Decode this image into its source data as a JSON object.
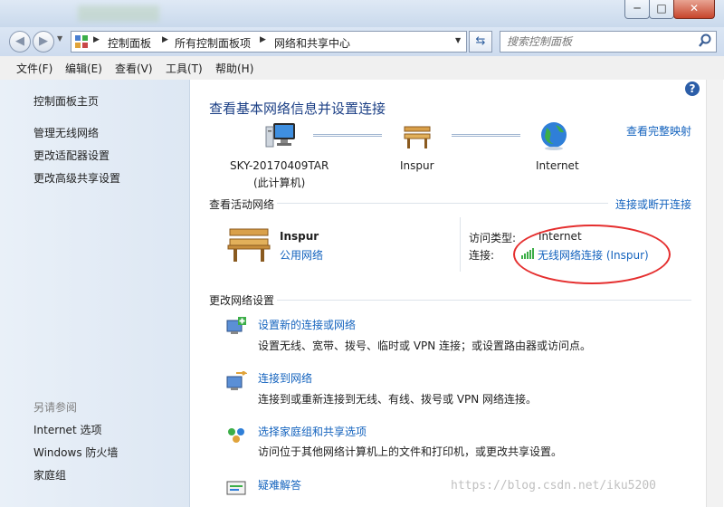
{
  "window": {
    "minimize": "─",
    "maximize": "□",
    "close": "✕"
  },
  "address": {
    "crumbs": [
      "控制面板",
      "所有控制面板项",
      "网络和共享中心"
    ],
    "search_placeholder": "搜索控制面板"
  },
  "menu": [
    "文件(F)",
    "编辑(E)",
    "查看(V)",
    "工具(T)",
    "帮助(H)"
  ],
  "sidebar": {
    "home": "控制面板主页",
    "links": [
      "管理无线网络",
      "更改适配器设置",
      "更改高级共享设置"
    ],
    "see_also_title": "另请参阅",
    "see_also": [
      "Internet 选项",
      "Windows 防火墙",
      "家庭组"
    ]
  },
  "main": {
    "title": "查看基本网络信息并设置连接",
    "full_map": "查看完整映射",
    "map": {
      "computer_name": "SKY-20170409TAR",
      "computer_sub": "(此计算机)",
      "network": "Inspur",
      "internet": "Internet"
    },
    "active_header": "查看活动网络",
    "connect_disconnect": "连接或断开连接",
    "active": {
      "name": "Inspur",
      "category": "公用网络",
      "access_label": "访问类型:",
      "access_value": "Internet",
      "conn_label": "连接:",
      "conn_value": "无线网络连接 (Inspur)"
    },
    "change_header": "更改网络设置",
    "tasks": [
      {
        "title": "设置新的连接或网络",
        "desc": "设置无线、宽带、拨号、临时或 VPN 连接；或设置路由器或访问点。"
      },
      {
        "title": "连接到网络",
        "desc": "连接到或重新连接到无线、有线、拨号或 VPN 网络连接。"
      },
      {
        "title": "选择家庭组和共享选项",
        "desc": "访问位于其他网络计算机上的文件和打印机，或更改共享设置。"
      },
      {
        "title": "疑难解答",
        "desc": ""
      }
    ],
    "help": "?"
  },
  "watermark": "https://blog.csdn.net/iku5200",
  "colors": {
    "link": "#1463be",
    "title": "#1b3f85",
    "highlight_oval": "#e52f2f"
  }
}
